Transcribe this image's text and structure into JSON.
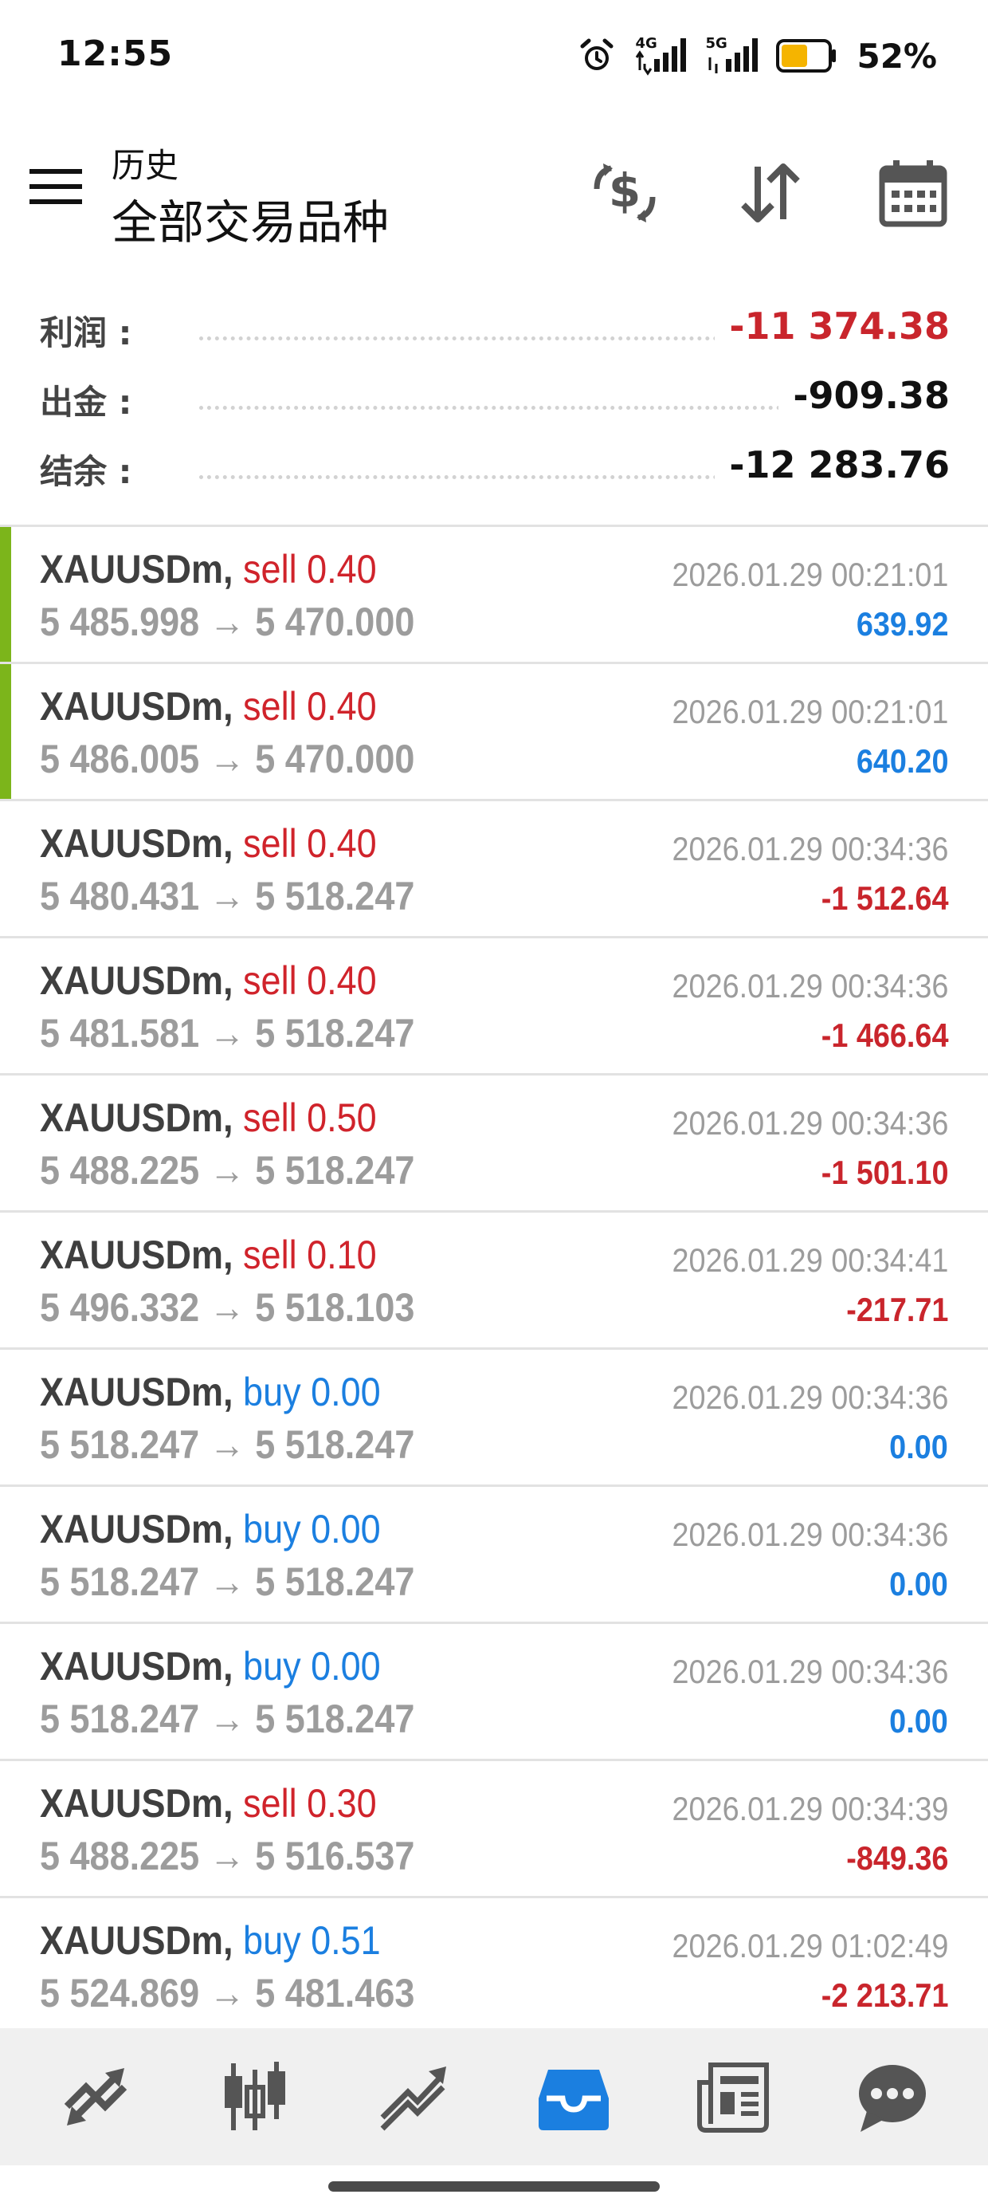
{
  "status_bar": {
    "time": "12:55",
    "battery": "52%",
    "icons": [
      "alarm-icon",
      "signal-4g-icon",
      "signal-5g-icon",
      "battery-icon"
    ],
    "net1": "4G",
    "net2": "5G",
    "battery_fill_color": "#f5b400"
  },
  "header": {
    "subtitle": "历史",
    "title": "全部交易品种",
    "actions": [
      "currency-exchange-icon",
      "sort-icon",
      "calendar-icon"
    ]
  },
  "summary": [
    {
      "label": "利润 :",
      "value": "-11 374.38",
      "negative": true
    },
    {
      "label": "出金 :",
      "value": "-909.38",
      "negative": false
    },
    {
      "label": "结余 :",
      "value": "-12 283.76",
      "negative": false
    }
  ],
  "deals": [
    {
      "symbol": "XAUUSDm,",
      "side": "sell 0.40",
      "type": "sell",
      "prices": "5 485.998 → 5 470.000",
      "time": "2026.01.29 00:21:01",
      "profit": "639.92",
      "highlight": true
    },
    {
      "symbol": "XAUUSDm,",
      "side": "sell 0.40",
      "type": "sell",
      "prices": "5 486.005 → 5 470.000",
      "time": "2026.01.29 00:21:01",
      "profit": "640.20",
      "highlight": true
    },
    {
      "symbol": "XAUUSDm,",
      "side": "sell 0.40",
      "type": "sell",
      "prices": "5 480.431 → 5 518.247",
      "time": "2026.01.29 00:34:36",
      "profit": "-1 512.64",
      "highlight": false
    },
    {
      "symbol": "XAUUSDm,",
      "side": "sell 0.40",
      "type": "sell",
      "prices": "5 481.581 → 5 518.247",
      "time": "2026.01.29 00:34:36",
      "profit": "-1 466.64",
      "highlight": false
    },
    {
      "symbol": "XAUUSDm,",
      "side": "sell 0.50",
      "type": "sell",
      "prices": "5 488.225 → 5 518.247",
      "time": "2026.01.29 00:34:36",
      "profit": "-1 501.10",
      "highlight": false
    },
    {
      "symbol": "XAUUSDm,",
      "side": "sell 0.10",
      "type": "sell",
      "prices": "5 496.332 → 5 518.103",
      "time": "2026.01.29 00:34:41",
      "profit": "-217.71",
      "highlight": false
    },
    {
      "symbol": "XAUUSDm,",
      "side": "buy 0.00",
      "type": "buy",
      "prices": "5 518.247 → 5 518.247",
      "time": "2026.01.29 00:34:36",
      "profit": "0.00",
      "highlight": false
    },
    {
      "symbol": "XAUUSDm,",
      "side": "buy 0.00",
      "type": "buy",
      "prices": "5 518.247 → 5 518.247",
      "time": "2026.01.29 00:34:36",
      "profit": "0.00",
      "highlight": false
    },
    {
      "symbol": "XAUUSDm,",
      "side": "buy 0.00",
      "type": "buy",
      "prices": "5 518.247 → 5 518.247",
      "time": "2026.01.29 00:34:36",
      "profit": "0.00",
      "highlight": false
    },
    {
      "symbol": "XAUUSDm,",
      "side": "sell 0.30",
      "type": "sell",
      "prices": "5 488.225 → 5 516.537",
      "time": "2026.01.29 00:34:39",
      "profit": "-849.36",
      "highlight": false
    },
    {
      "symbol": "XAUUSDm,",
      "side": "buy 0.51",
      "type": "buy",
      "prices": "5 524.869 → 5 481.463",
      "time": "2026.01.29 01:02:49",
      "profit": "-2 213.71",
      "highlight": false
    }
  ],
  "nav": {
    "items": [
      "quotes-icon",
      "chart-icon",
      "trade-icon",
      "history-icon",
      "news-icon",
      "chat-icon"
    ],
    "active": "history-icon"
  },
  "colors": {
    "sell": "#d0232b",
    "buy": "#1b7fe0",
    "negative": "#c9252c",
    "positive": "#1b7fe0",
    "highlight_bar": "#7cb51b",
    "active_nav": "#1b7fe0"
  }
}
